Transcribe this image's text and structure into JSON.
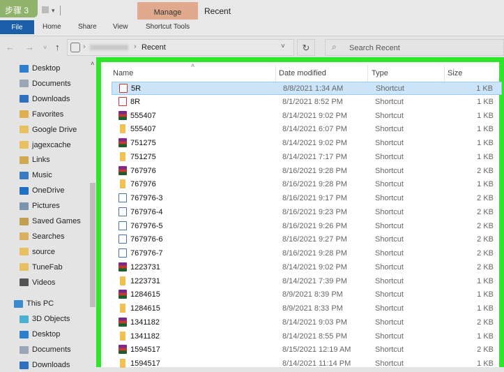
{
  "step_badge": "步骤 3",
  "title_bar": {
    "context_tab": "Manage",
    "window_title": "Recent"
  },
  "ribbon": {
    "file": "File",
    "tabs": [
      "Home",
      "Share",
      "View"
    ],
    "context_tab": "Shortcut Tools"
  },
  "address": {
    "current": "Recent",
    "search_placeholder": "Search Recent"
  },
  "sidebar": {
    "quick_access": [
      {
        "label": "Desktop",
        "icon": "desktop",
        "color": "#2f7fd0"
      },
      {
        "label": "Documents",
        "icon": "documents",
        "color": "#9aa6b4"
      },
      {
        "label": "Downloads",
        "icon": "downloads",
        "color": "#2f6fc0"
      },
      {
        "label": "Favorites",
        "icon": "favorites",
        "color": "#e0b050"
      },
      {
        "label": "Google Drive",
        "icon": "folder",
        "color": "#e8c060"
      },
      {
        "label": "jagexcache",
        "icon": "folder",
        "color": "#e8c060"
      },
      {
        "label": "Links",
        "icon": "links",
        "color": "#d0a850"
      },
      {
        "label": "Music",
        "icon": "music",
        "color": "#3a7ac0"
      },
      {
        "label": "OneDrive",
        "icon": "onedrive",
        "color": "#1f6fc4"
      },
      {
        "label": "Pictures",
        "icon": "pictures",
        "color": "#7a94b0"
      },
      {
        "label": "Saved Games",
        "icon": "saved-games",
        "color": "#c0a050"
      },
      {
        "label": "Searches",
        "icon": "searches",
        "color": "#d8b060"
      },
      {
        "label": "source",
        "icon": "folder",
        "color": "#e8c060"
      },
      {
        "label": "TuneFab",
        "icon": "folder",
        "color": "#e8c060"
      },
      {
        "label": "Videos",
        "icon": "videos",
        "color": "#555"
      }
    ],
    "this_pc": {
      "label": "This PC",
      "color": "#3a8ad0"
    },
    "pc_items": [
      {
        "label": "3D Objects",
        "icon": "3d-objects",
        "color": "#4ab0d0"
      },
      {
        "label": "Desktop",
        "icon": "desktop",
        "color": "#2f7fd0"
      },
      {
        "label": "Documents",
        "icon": "documents",
        "color": "#9aa6b4"
      },
      {
        "label": "Downloads",
        "icon": "downloads",
        "color": "#2f6fc0"
      }
    ]
  },
  "columns": {
    "name": "Name",
    "date": "Date modified",
    "type": "Type",
    "size": "Size"
  },
  "files": [
    {
      "name": "5R",
      "date": "8/8/2021 1:34 AM",
      "type": "Shortcut",
      "size": "1 KB",
      "icon": "pdf",
      "selected": true
    },
    {
      "name": "8R",
      "date": "8/1/2021 8:52 PM",
      "type": "Shortcut",
      "size": "1 KB",
      "icon": "pdf"
    },
    {
      "name": "555407",
      "date": "8/14/2021 9:02 PM",
      "type": "Shortcut",
      "size": "1 KB",
      "icon": "rar"
    },
    {
      "name": "555407",
      "date": "8/14/2021 6:07 PM",
      "type": "Shortcut",
      "size": "1 KB",
      "icon": "folder"
    },
    {
      "name": "751275",
      "date": "8/14/2021 9:02 PM",
      "type": "Shortcut",
      "size": "1 KB",
      "icon": "rar"
    },
    {
      "name": "751275",
      "date": "8/14/2021 7:17 PM",
      "type": "Shortcut",
      "size": "1 KB",
      "icon": "folder"
    },
    {
      "name": "767976",
      "date": "8/16/2021 9:28 PM",
      "type": "Shortcut",
      "size": "2 KB",
      "icon": "rar"
    },
    {
      "name": "767976",
      "date": "8/16/2021 9:28 PM",
      "type": "Shortcut",
      "size": "1 KB",
      "icon": "folder"
    },
    {
      "name": "767976-3",
      "date": "8/16/2021 9:17 PM",
      "type": "Shortcut",
      "size": "2 KB",
      "icon": "img"
    },
    {
      "name": "767976-4",
      "date": "8/16/2021 9:23 PM",
      "type": "Shortcut",
      "size": "2 KB",
      "icon": "img"
    },
    {
      "name": "767976-5",
      "date": "8/16/2021 9:26 PM",
      "type": "Shortcut",
      "size": "2 KB",
      "icon": "img"
    },
    {
      "name": "767976-6",
      "date": "8/16/2021 9:27 PM",
      "type": "Shortcut",
      "size": "2 KB",
      "icon": "img"
    },
    {
      "name": "767976-7",
      "date": "8/16/2021 9:28 PM",
      "type": "Shortcut",
      "size": "2 KB",
      "icon": "img"
    },
    {
      "name": "1223731",
      "date": "8/14/2021 9:02 PM",
      "type": "Shortcut",
      "size": "2 KB",
      "icon": "rar"
    },
    {
      "name": "1223731",
      "date": "8/14/2021 7:39 PM",
      "type": "Shortcut",
      "size": "1 KB",
      "icon": "folder"
    },
    {
      "name": "1284615",
      "date": "8/9/2021 8:39 PM",
      "type": "Shortcut",
      "size": "1 KB",
      "icon": "rar"
    },
    {
      "name": "1284615",
      "date": "8/9/2021 8:33 PM",
      "type": "Shortcut",
      "size": "1 KB",
      "icon": "folder"
    },
    {
      "name": "1341182",
      "date": "8/14/2021 9:03 PM",
      "type": "Shortcut",
      "size": "2 KB",
      "icon": "rar"
    },
    {
      "name": "1341182",
      "date": "8/14/2021 8:55 PM",
      "type": "Shortcut",
      "size": "1 KB",
      "icon": "folder"
    },
    {
      "name": "1594517",
      "date": "8/15/2021 12:19 AM",
      "type": "Shortcut",
      "size": "2 KB",
      "icon": "rar"
    },
    {
      "name": "1594517",
      "date": "8/14/2021 11:14 PM",
      "type": "Shortcut",
      "size": "1 KB",
      "icon": "folder"
    }
  ],
  "highlight_color": "#2ee62a"
}
